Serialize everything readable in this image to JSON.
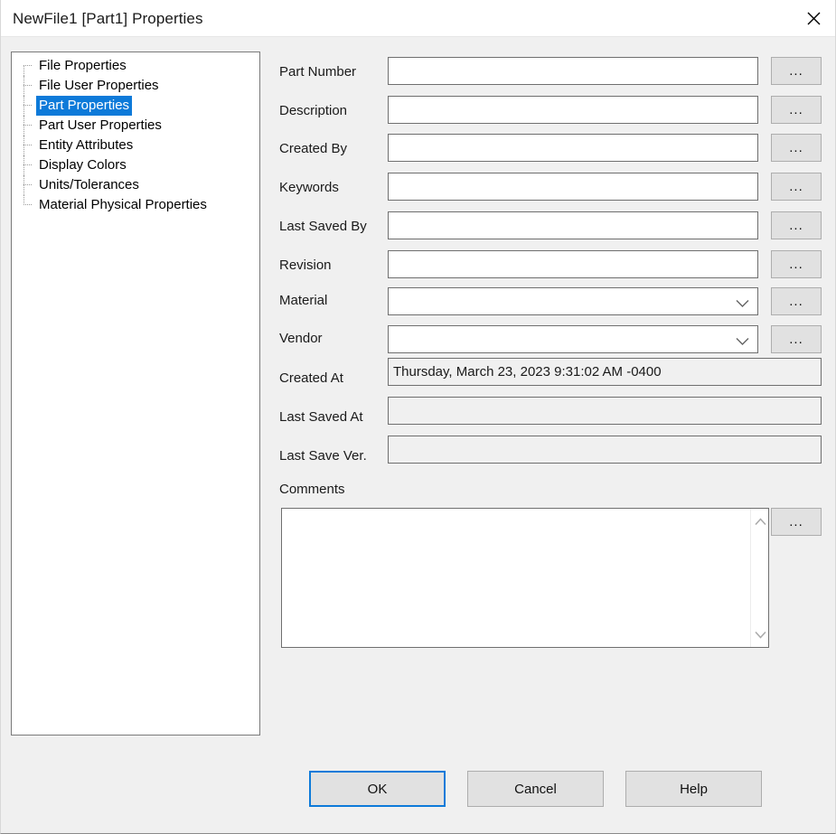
{
  "window": {
    "title": "NewFile1 [Part1] Properties",
    "close_icon": "close-icon",
    "accent_color": "#0d7ad9",
    "background_color": "#f0f0f0",
    "selection_color": "#0d7ad9"
  },
  "tree": {
    "items": [
      {
        "label": "File Properties",
        "selected": false
      },
      {
        "label": "File User Properties",
        "selected": false
      },
      {
        "label": "Part Properties",
        "selected": true
      },
      {
        "label": "Part User Properties",
        "selected": false
      },
      {
        "label": "Entity Attributes",
        "selected": false
      },
      {
        "label": "Display Colors",
        "selected": false
      },
      {
        "label": "Units/Tolerances",
        "selected": false
      },
      {
        "label": "Material Physical Properties",
        "selected": false
      }
    ]
  },
  "form": {
    "browse_label": "...",
    "chevron_icon": "chevron-down-icon",
    "fields": {
      "part_number": {
        "label": "Part Number",
        "value": "",
        "placeholder": ""
      },
      "description": {
        "label": "Description",
        "value": "",
        "placeholder": ""
      },
      "created_by": {
        "label": "Created By",
        "value": "",
        "placeholder": ""
      },
      "keywords": {
        "label": "Keywords",
        "value": "",
        "placeholder": ""
      },
      "last_saved_by": {
        "label": "Last Saved By",
        "value": "",
        "placeholder": ""
      },
      "revision": {
        "label": "Revision",
        "value": "",
        "placeholder": ""
      },
      "material": {
        "label": "Material",
        "value": ""
      },
      "vendor": {
        "label": "Vendor",
        "value": ""
      },
      "created_at": {
        "label": "Created At",
        "value": "Thursday, March 23, 2023 9:31:02 AM -0400"
      },
      "last_saved_at": {
        "label": "Last Saved At",
        "value": ""
      },
      "last_save_ver": {
        "label": "Last Save Ver.",
        "value": ""
      },
      "comments": {
        "label": "Comments",
        "value": "",
        "placeholder": ""
      }
    }
  },
  "footer": {
    "ok": "OK",
    "cancel": "Cancel",
    "help": "Help"
  }
}
